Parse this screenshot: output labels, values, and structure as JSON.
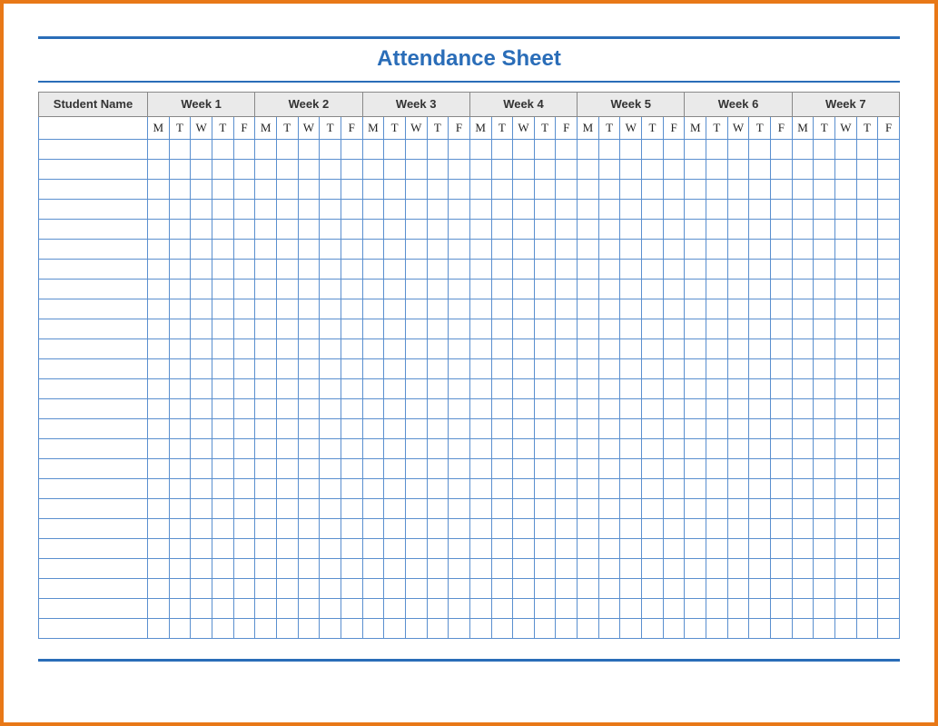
{
  "title": "Attendance Sheet",
  "headers": {
    "name": "Student Name",
    "weeks": [
      "Week 1",
      "Week 2",
      "Week 3",
      "Week 4",
      "Week 5",
      "Week 6",
      "Week 7"
    ]
  },
  "days": [
    "M",
    "T",
    "W",
    "T",
    "F"
  ],
  "row_count": 25
}
